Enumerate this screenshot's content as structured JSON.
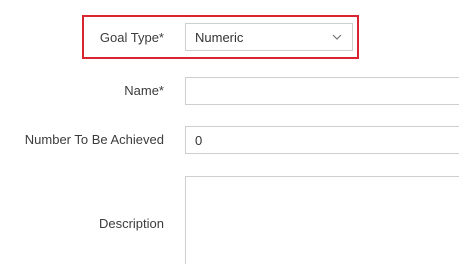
{
  "form": {
    "goal_type": {
      "label": "Goal Type*",
      "selected": "Numeric",
      "icon": "chevron-down-icon",
      "highlight_color": "#d9252f"
    },
    "name": {
      "label": "Name*",
      "value": ""
    },
    "number_to_be_achieved": {
      "label": "Number To Be Achieved",
      "value": "0"
    },
    "description": {
      "label": "Description",
      "value": ""
    }
  }
}
